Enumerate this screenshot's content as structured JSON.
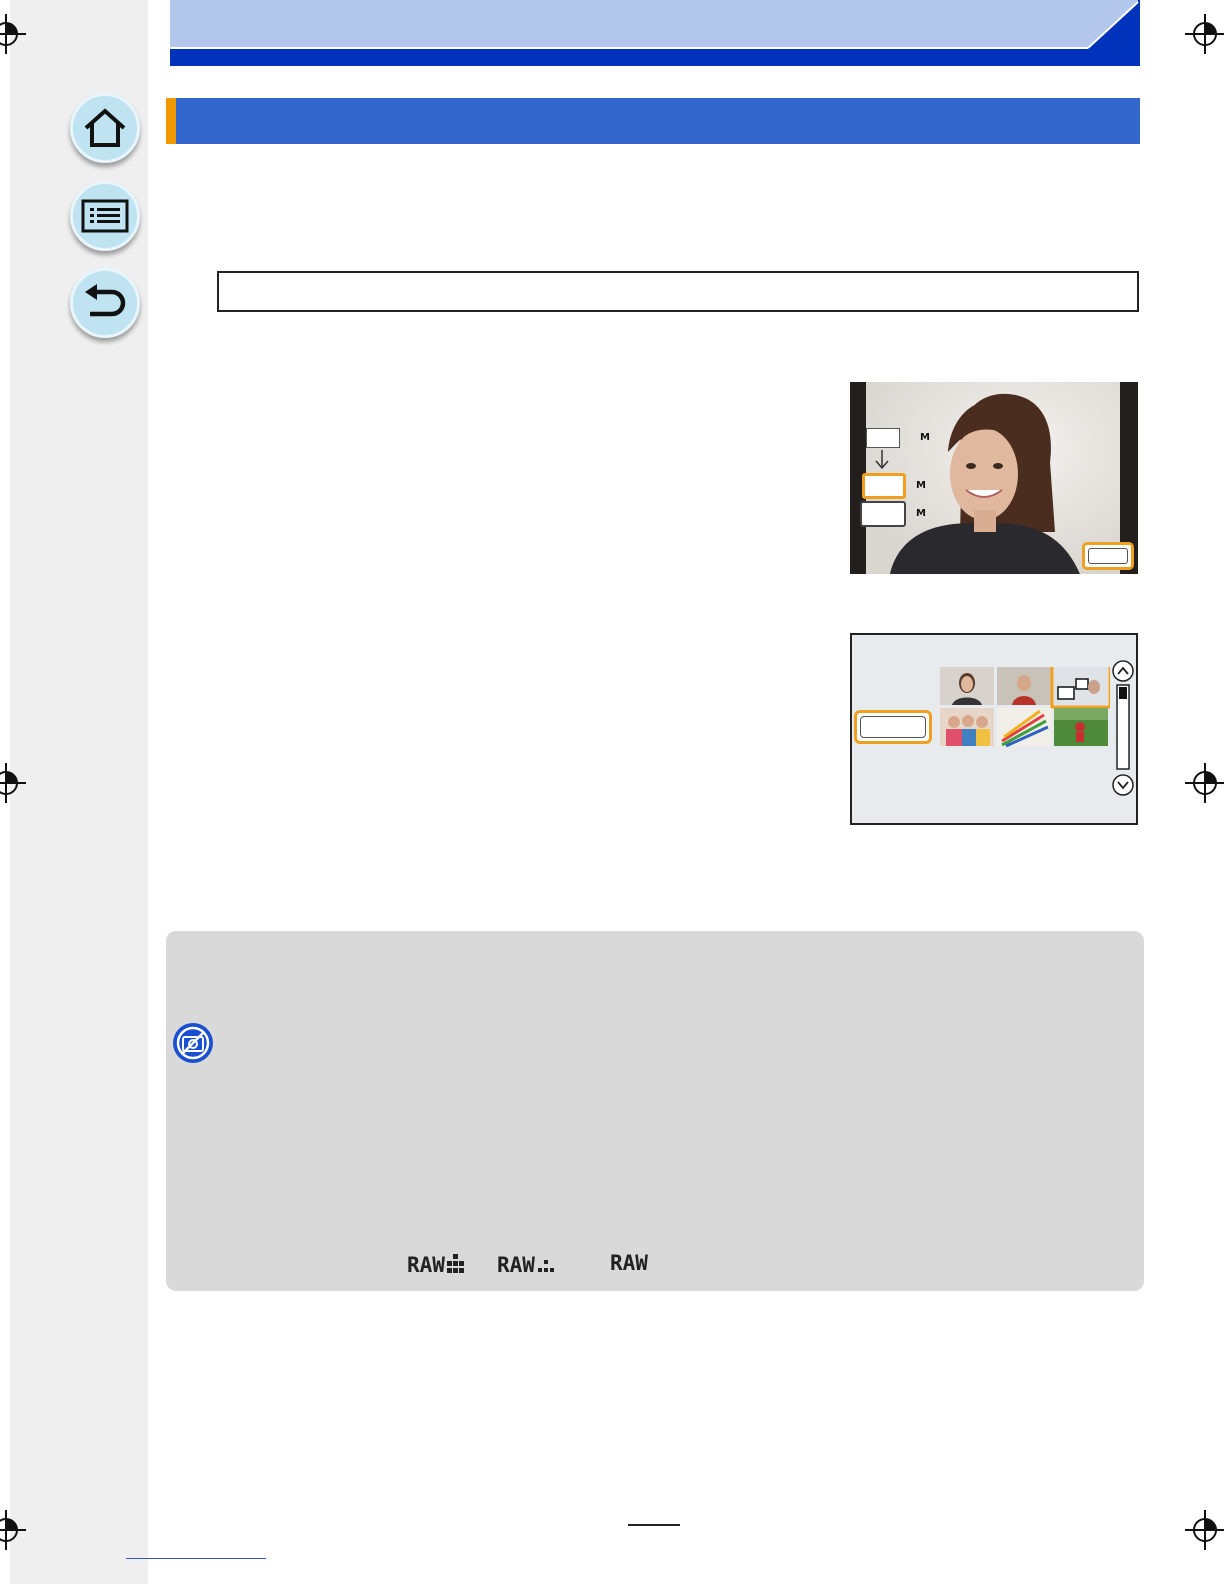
{
  "navigation": {
    "home_icon": "home-icon",
    "contents_icon": "list-icon",
    "back_icon": "return-arrow-icon"
  },
  "colors": {
    "header_light": "#b3c6ec",
    "header_dark": "#0033bb",
    "section_bar": "#3366cc",
    "section_accent": "#f09a00",
    "highlight_orange": "#f0a020",
    "note_panel": "#d9d9d9",
    "prohibit_icon": "#1a4fd0"
  },
  "shot1": {
    "size_units": [
      "M",
      "M",
      "M"
    ]
  },
  "notes": {
    "prohibit_icon": "no-camera-icon",
    "raw_icons": [
      "RAW▒",
      "RAW░",
      "RAW"
    ]
  }
}
